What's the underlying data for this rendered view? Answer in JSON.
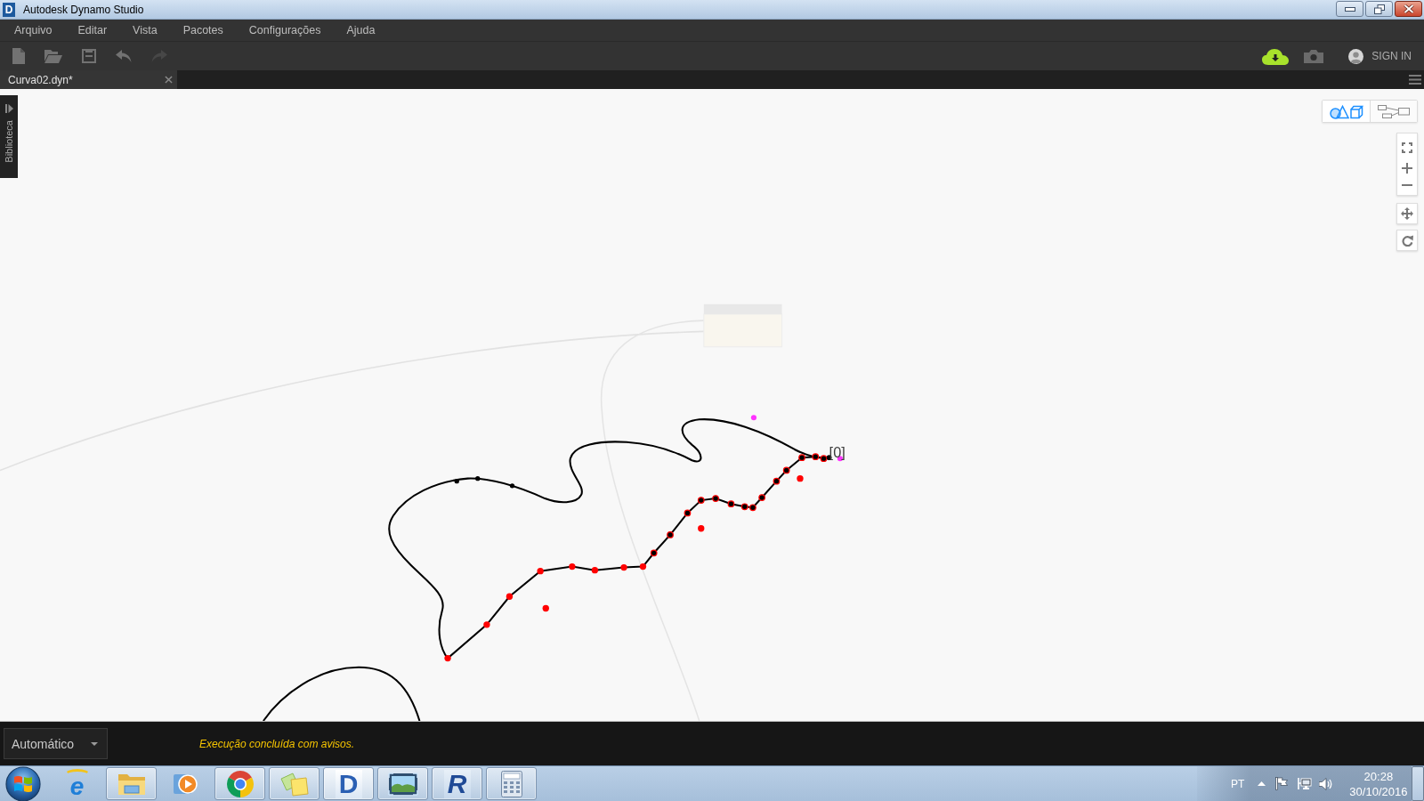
{
  "window": {
    "title": "Autodesk Dynamo Studio",
    "icon_letter": "D"
  },
  "menu": [
    {
      "label": "Arquivo"
    },
    {
      "label": "Editar"
    },
    {
      "label": "Vista"
    },
    {
      "label": "Pacotes"
    },
    {
      "label": "Configurações"
    },
    {
      "label": "Ajuda"
    }
  ],
  "toolbar": [
    {
      "kind": "new",
      "disabled": false
    },
    {
      "kind": "open",
      "disabled": false
    },
    {
      "kind": "save",
      "disabled": false
    },
    {
      "kind": "undo",
      "disabled": false
    },
    {
      "kind": "redo",
      "disabled": true
    }
  ],
  "account": {
    "label": "SIGN IN"
  },
  "tabs": [
    {
      "label": "Curva02.dyn*",
      "selected": true
    }
  ],
  "library": {
    "label": "Biblioteca"
  },
  "view_modes": [
    {
      "kind": "geometry",
      "selected": true
    },
    {
      "kind": "graph",
      "selected": false
    }
  ],
  "canvas": {
    "index_label": "[0]"
  },
  "status_bar": {
    "run_mode": "Automático",
    "message": "Execução concluída com avisos."
  },
  "taskbar": {
    "apps": [
      {
        "kind": "ebrowser",
        "letter": "e",
        "running": false,
        "selected": false
      },
      {
        "kind": "folder",
        "running": true,
        "selected": false
      },
      {
        "kind": "player",
        "running": false,
        "selected": false
      },
      {
        "kind": "globe",
        "running": true,
        "selected": false
      },
      {
        "kind": "notes",
        "running": true,
        "selected": false
      },
      {
        "kind": "dtile",
        "letter": "D",
        "running": true,
        "selected": true
      },
      {
        "kind": "photo",
        "running": true,
        "selected": false
      },
      {
        "kind": "rtile",
        "letter": "R",
        "running": true,
        "selected": false
      },
      {
        "kind": "calculator",
        "running": true,
        "selected": false
      }
    ],
    "language": "PT",
    "time": "20:28",
    "date": "30/10/2016"
  }
}
